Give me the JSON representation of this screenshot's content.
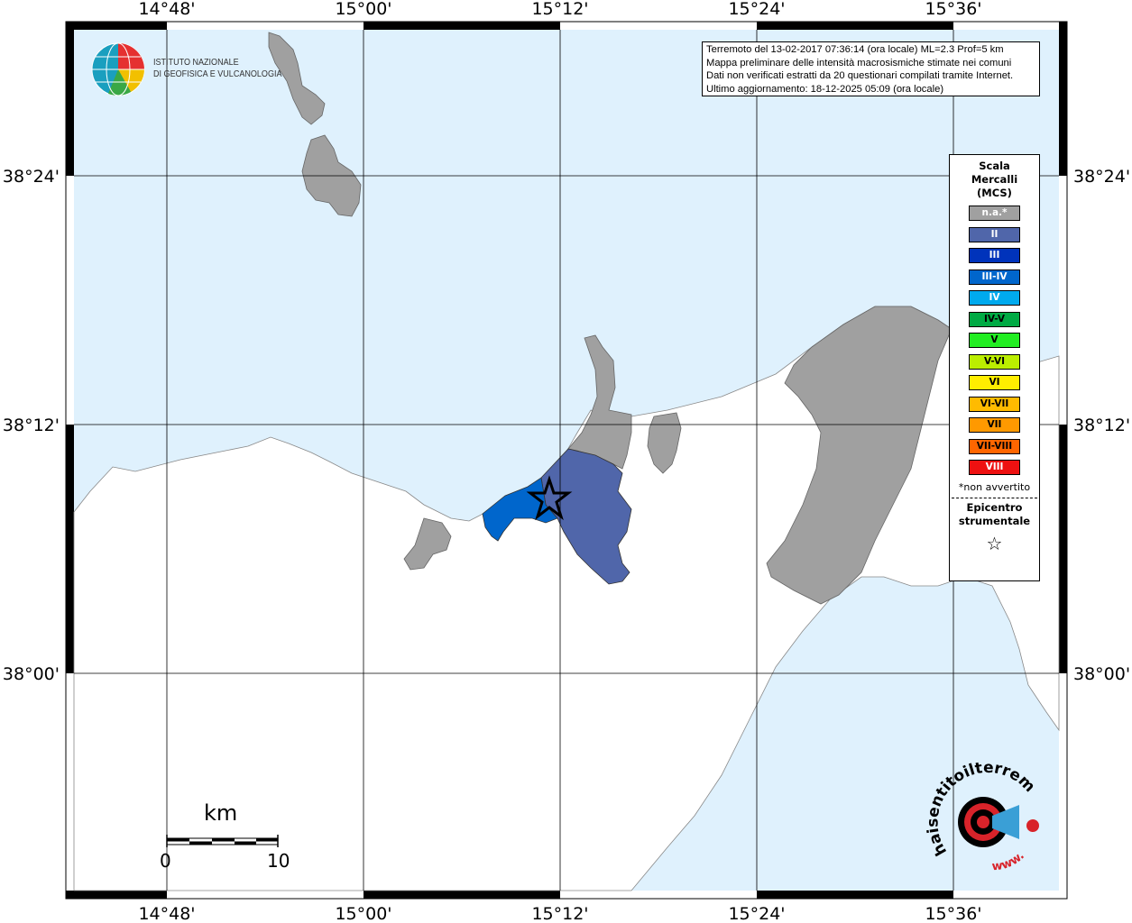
{
  "info": {
    "line1": "Terremoto del 13-02-2017 07:36:14 (ora locale) ML=2.3 Prof=5 km",
    "line2": "Mappa preliminare delle intensità macrosismiche stimate nei comuni",
    "line3": "Dati non verificati estratti da 20 questionari compilati tramite Internet.",
    "line4": "Ultimo aggiornamento: 18-12-2025 05:09 (ora locale)"
  },
  "axes": {
    "lon_labels": [
      "14°48'",
      "15°00'",
      "15°12'",
      "15°24'",
      "15°36'"
    ],
    "lat_labels": [
      "38°24'",
      "38°12'",
      "38°00'"
    ]
  },
  "logo": {
    "ingv_line1": "ISTITUTO NAZIONALE",
    "ingv_line2": "DI GEOFISICA E VULCANOLOGIA",
    "hsit_text": "haisentitoilterremoto.it",
    "hsit_www": "www."
  },
  "legend": {
    "title_line1": "Scala",
    "title_line2": "Mercalli",
    "title_line3": "(MCS)",
    "items": [
      {
        "label": "n.a.*",
        "color": "#a0a0a0"
      },
      {
        "label": "II",
        "color": "#5066aa"
      },
      {
        "label": "III",
        "color": "#0033bb"
      },
      {
        "label": "III-IV",
        "color": "#0066cc"
      },
      {
        "label": "IV",
        "color": "#00aaee"
      },
      {
        "label": "IV-V",
        "color": "#00aa44"
      },
      {
        "label": "V",
        "color": "#22ee22"
      },
      {
        "label": "V-VI",
        "color": "#bbee00"
      },
      {
        "label": "VI",
        "color": "#ffee00"
      },
      {
        "label": "VI-VII",
        "color": "#ffbb00"
      },
      {
        "label": "VII",
        "color": "#ff9900"
      },
      {
        "label": "VII-VIII",
        "color": "#ff6600"
      },
      {
        "label": "VIII",
        "color": "#ee1111"
      }
    ],
    "note": "*non avvertito",
    "epicentre_line1": "Epicentro",
    "epicentre_line2": "strumentale",
    "star": "☆"
  },
  "scalebar": {
    "unit": "km",
    "min_label": "0",
    "max_label": "10"
  },
  "colors": {
    "sea": "#dff1fd",
    "land": "#ffffff",
    "na_municipality": "#a0a0a0",
    "intensity_II": "#5066aa",
    "intensity_III_IV": "#0066cc"
  }
}
